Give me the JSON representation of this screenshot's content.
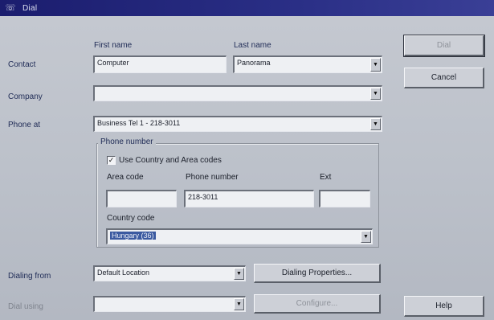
{
  "window": {
    "title": "Dial"
  },
  "labels": {
    "first_name": "First name",
    "last_name": "Last name",
    "contact": "Contact",
    "company": "Company",
    "phone_at": "Phone at",
    "dialing_from": "Dialing from",
    "dial_using": "Dial using"
  },
  "contact": {
    "first_name": "Computer",
    "last_name": "Panorama"
  },
  "company": {
    "value": ""
  },
  "phone_at": {
    "value": "Business Tel 1 - 218-3011"
  },
  "phone_number_group": {
    "title": "Phone number",
    "use_codes_label": "Use Country and Area codes",
    "use_codes_checked": true,
    "area_code_label": "Area code",
    "area_code_value": "",
    "phone_number_label": "Phone number",
    "phone_number_value": "218-3011",
    "ext_label": "Ext",
    "ext_value": "",
    "country_code_label": "Country code",
    "country_code_value": "Hungary (36)"
  },
  "dialing_from": {
    "value": "Default Location"
  },
  "dial_using": {
    "value": ""
  },
  "buttons": {
    "dial": "Dial",
    "cancel": "Cancel",
    "dialing_properties": "Dialing Properties...",
    "configure": "Configure...",
    "help": "Help"
  },
  "icons": {
    "window": "dial-window-icon",
    "dropdown": "chevron-down-icon",
    "check": "checkmark-icon"
  }
}
